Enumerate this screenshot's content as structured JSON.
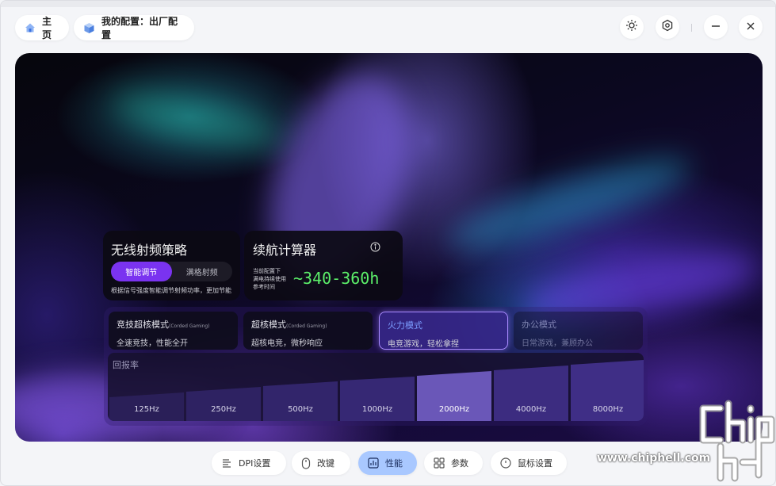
{
  "header": {
    "home_label": "主页",
    "config_label": "我的配置：出厂配置"
  },
  "wireless": {
    "title": "无线射频策略",
    "options": [
      "智能调节",
      "满格射频"
    ],
    "selected": "智能调节",
    "description": "根据信号强度智能调节射频功率，更加节能"
  },
  "battery": {
    "title": "续航计算器",
    "caption_lines": [
      "当前配置下",
      "满电持续使用",
      "参考时间"
    ],
    "value": "~340-360h"
  },
  "modes": [
    {
      "title": "竞技超核模式",
      "tag": "(Corded Gaming)",
      "subtitle": "全速竞技，性能全开"
    },
    {
      "title": "超核模式",
      "tag": "(Corded Gaming)",
      "subtitle": "超核电竞，微秒响应"
    },
    {
      "title": "火力模式",
      "tag": "",
      "subtitle": "电竞游戏，轻松拿捏"
    },
    {
      "title": "办公模式",
      "tag": "",
      "subtitle": "日常游戏，兼顾办公"
    }
  ],
  "polling": {
    "label": "回报率",
    "rates": [
      "125Hz",
      "250Hz",
      "500Hz",
      "1000Hz",
      "2000Hz",
      "4000Hz",
      "8000Hz"
    ],
    "selected": "2000Hz"
  },
  "bottom_nav": [
    {
      "label": "DPI设置",
      "icon": "dpi-icon"
    },
    {
      "label": "改键",
      "icon": "mouse-button-icon"
    },
    {
      "label": "性能",
      "icon": "performance-chart-icon"
    },
    {
      "label": "参数",
      "icon": "grid-icon"
    },
    {
      "label": "鼠标设置",
      "icon": "mouse-icon"
    }
  ],
  "active_nav": "性能",
  "watermark": {
    "logo_text": "chip hell",
    "url": "www.chiphell.com"
  },
  "colors": {
    "accent": "#7a33f0",
    "battery_value": "#5cf06a",
    "active_nav": "#a9c8ff"
  }
}
